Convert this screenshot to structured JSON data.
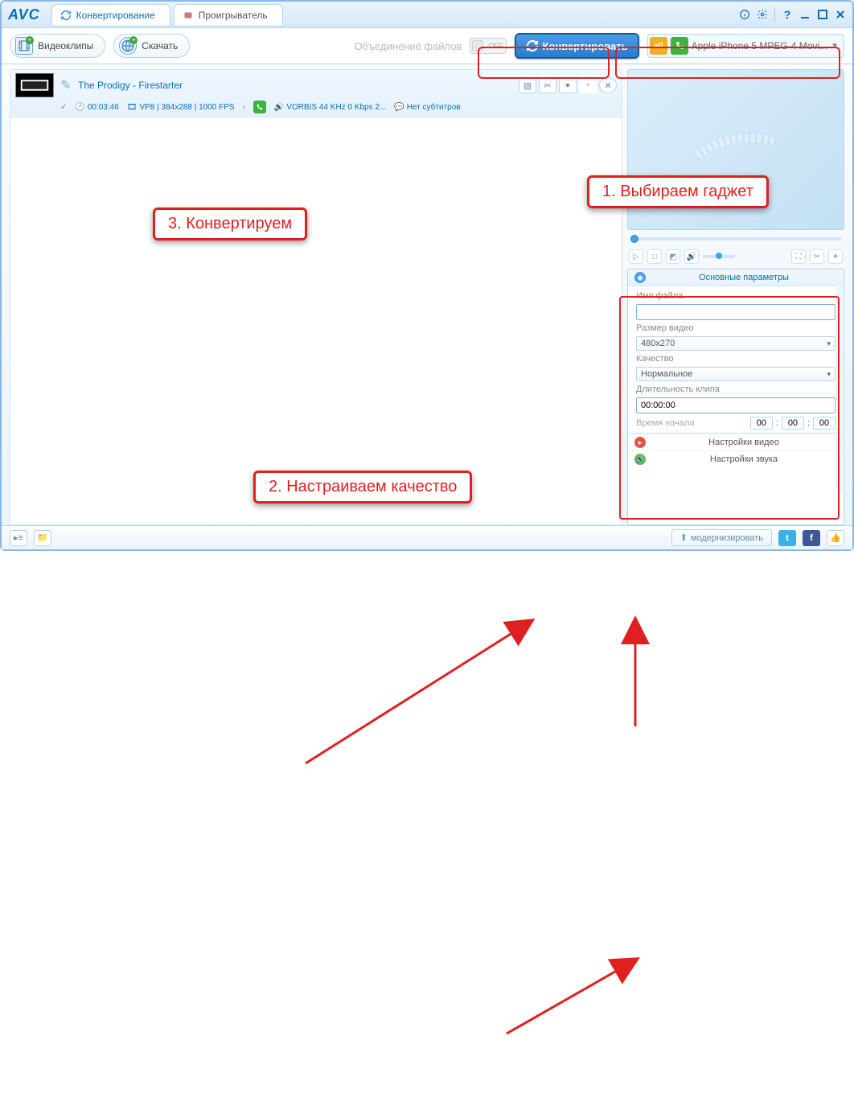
{
  "header": {
    "logo": "AVC",
    "tabs": [
      {
        "label": "Конвертирование",
        "active": true
      },
      {
        "label": "Проигрыватель",
        "active": false
      }
    ]
  },
  "toolbar": {
    "videoClipsLabel": "Видеоклипы",
    "downloadLabel": "Скачать",
    "mergeLabel": "Объединение файлов",
    "toggleOff": "OFF",
    "convertLabel": "Конвертировать",
    "allBadge": "all",
    "deviceLabel": "Apple iPhone 5 MPEG-4 Movi..."
  },
  "clip": {
    "title": "The Prodigy - Firestarter",
    "duration": "00:03:46",
    "format": "VP8 | 384x288 | 1000 FPS",
    "audio": "VORBIS 44 KHz 0 Kbps 2...",
    "subs": "Нет субтитров"
  },
  "params": {
    "header": "Основные параметры",
    "fileNameLabel": "Имя файла",
    "fileNameValue": "",
    "videoSizeLabel": "Размер видео",
    "videoSizeValue": "480x270",
    "qualityLabel": "Качество",
    "qualityValue": "Нормальное",
    "durationLabel": "Длительность клипа",
    "durationValue": "00:00:00",
    "startTimeLabel": "Время начала",
    "t1": "00",
    "t2": "00",
    "t3": "00",
    "videoSettings": "Настройки видео",
    "audioSettings": "Настройки звука"
  },
  "statusbar": {
    "upgradeLabel": "модернизировать"
  },
  "callouts": {
    "c1": "1. Выбираем гаджет",
    "c2": "2. Настраиваем качество",
    "c3": "3. Конвертируем"
  }
}
